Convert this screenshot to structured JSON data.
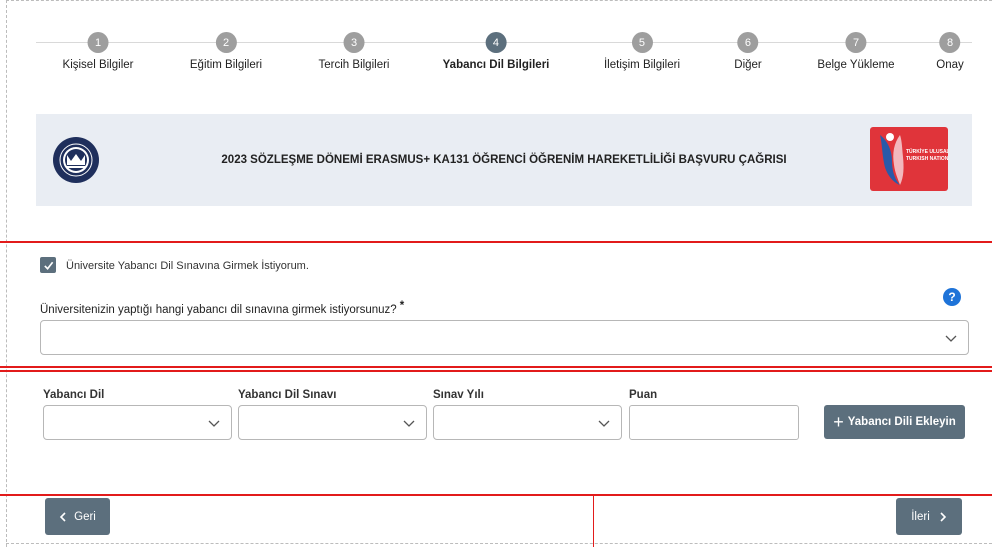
{
  "stepper": {
    "steps": [
      {
        "num": "1",
        "label": "Kişisel Bilgiler"
      },
      {
        "num": "2",
        "label": "Eğitim Bilgileri"
      },
      {
        "num": "3",
        "label": "Tercih Bilgileri"
      },
      {
        "num": "4",
        "label": "Yabancı Dil Bilgileri"
      },
      {
        "num": "5",
        "label": "İletişim Bilgileri"
      },
      {
        "num": "6",
        "label": "Diğer"
      },
      {
        "num": "7",
        "label": "Belge Yükleme"
      },
      {
        "num": "8",
        "label": "Onay"
      }
    ],
    "active_step": "4"
  },
  "banner": {
    "title": "2023 SÖZLEŞME DÖNEMİ ERASMUS+ KA131 ÖĞRENCİ ÖĞRENİM HAREKETLİLİĞİ BAŞVURU ÇAĞRISI",
    "logo_right_text": "TÜRKİYE ULUSAL AJANSI\nTURKISH NATIONAL AGENCY"
  },
  "exam_section": {
    "checkbox_label": "Üniversite Yabancı Dil Sınavına Girmek İstiyorum.",
    "checked": true,
    "question": "Üniversitenizin yaptığı hangi yabancı dil sınavına girmek istiyorsunuz?",
    "required_mark": "*",
    "help_symbol": "?",
    "select_value": ""
  },
  "language_form": {
    "labels": {
      "language": "Yabancı Dil",
      "exam": "Yabancı Dil Sınavı",
      "year": "Sınav Yılı",
      "score": "Puan"
    },
    "add_button": "Yabancı Dili Ekleyin",
    "add_symbol": "+"
  },
  "nav": {
    "back": "Geri",
    "next": "İleri"
  },
  "colors": {
    "primary": "#5c6f7d",
    "step_inactive": "#9e9e9e",
    "banner_bg": "#e9edf3",
    "separator": "#e21b1b",
    "help": "#1e73d8"
  }
}
